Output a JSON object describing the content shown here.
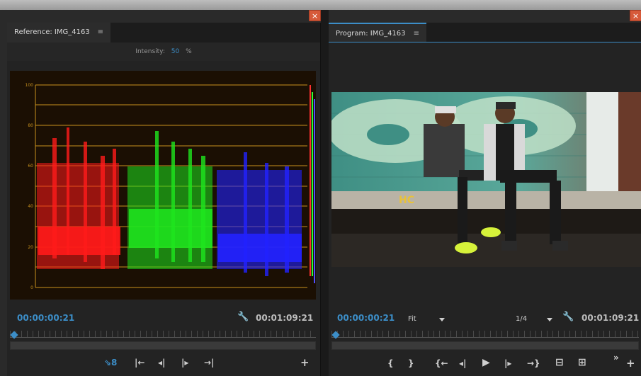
{
  "reference": {
    "tab_label": "Reference: IMG_4163",
    "menu_icon": "≡",
    "intensity_label": "Intensity:",
    "intensity_value": "50",
    "intensity_unit": "%",
    "timecode_current": "00:00:00:21",
    "timecode_total": "00:01:09:21",
    "scope_ticks": [
      "100",
      "80",
      "60",
      "40",
      "20",
      "0"
    ]
  },
  "program": {
    "tab_label": "Program: IMG_4163",
    "menu_icon": "≡",
    "timecode_current": "00:00:00:21",
    "timecode_total": "00:01:09:21",
    "zoom_value": "Fit",
    "resolution_value": "1/4",
    "graffiti_text": "HC"
  },
  "controls": {
    "ref": {
      "marker": "⇘8",
      "step_back": "|←",
      "frame_back": "◂|",
      "frame_fwd": "|▸",
      "step_fwd": "→|",
      "add": "+"
    },
    "prog": {
      "mark_in": "{",
      "mark_out": "}",
      "goto_in": "{←",
      "frame_back": "◂|",
      "play": "▶",
      "frame_fwd": "|▸",
      "goto_out": "→}",
      "lift": "⊟",
      "extract": "⊞",
      "more": "»",
      "add": "+"
    }
  },
  "icons": [
    "close-icon",
    "menu-icon",
    "wrench-icon",
    "dropdown-icon",
    "playhead-icon",
    "marker-icon"
  ]
}
